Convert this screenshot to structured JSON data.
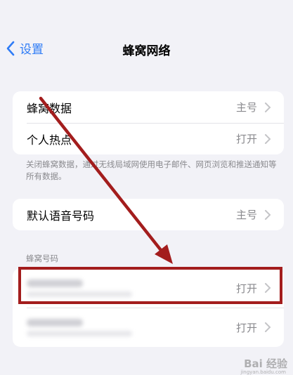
{
  "nav": {
    "back_label": "设置",
    "title": "蜂窝网络"
  },
  "group1": [
    {
      "label": "蜂窝数据",
      "value": "主号"
    },
    {
      "label": "个人热点",
      "value": "打开"
    }
  ],
  "footnote": "关闭蜂窝数据，通过无线局域网使用电子邮件、网页浏览和推送通知等所有数据。",
  "group2": [
    {
      "label": "默认语音号码",
      "value": "主号"
    }
  ],
  "section_header": "蜂窝号码",
  "group3": [
    {
      "value": "打开"
    },
    {
      "value": "打开"
    }
  ],
  "annotation_color": "#a31d1d",
  "watermark": {
    "text": "Bai 经验",
    "sub": "jingyan.baidu.com"
  }
}
